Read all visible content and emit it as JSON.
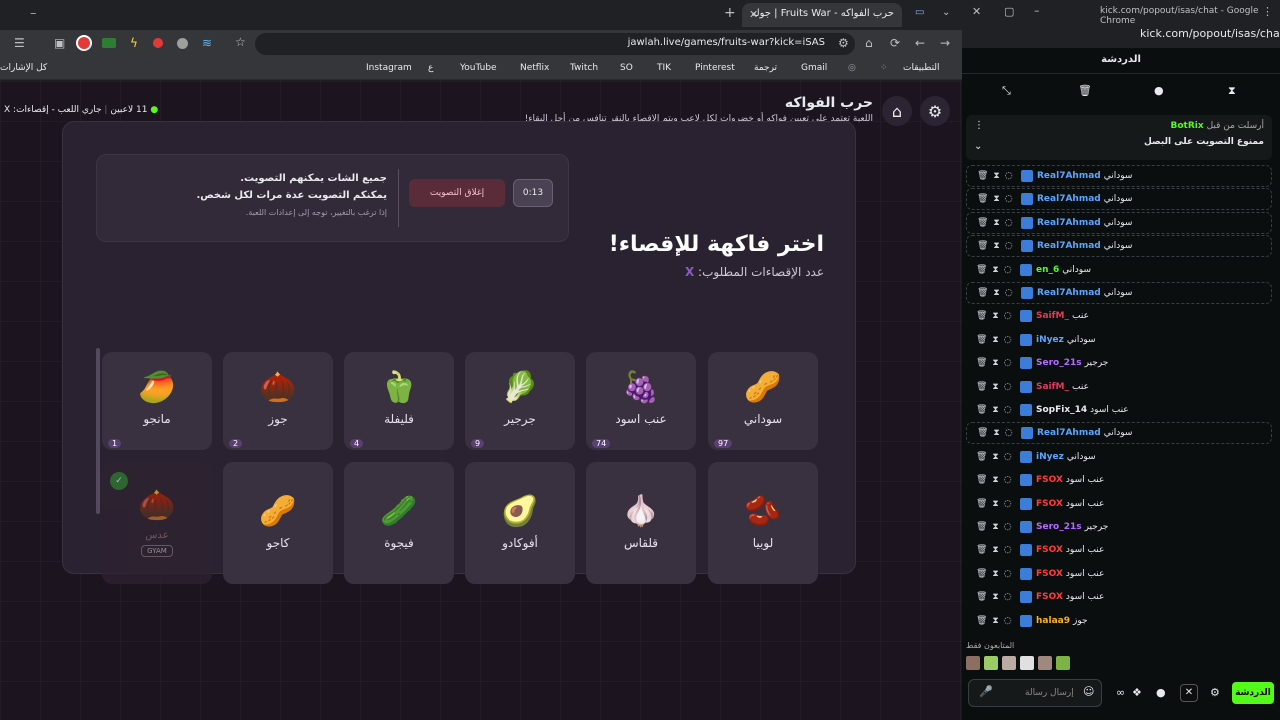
{
  "browser": {
    "tab_title": "حرب الفواكه - Fruits War | جوله",
    "url": "jawlah.live/games/fruits-war?kick=iSAS",
    "bookmarks": [
      {
        "label": "التطبيقات"
      },
      {
        "label": "Gmail"
      },
      {
        "label": "ترجمة"
      },
      {
        "label": "Pinterest"
      },
      {
        "label": "TIK"
      },
      {
        "label": "SO"
      },
      {
        "label": "Twitch"
      },
      {
        "label": "Netflix"
      },
      {
        "label": "YouTube"
      },
      {
        "label": "ع"
      },
      {
        "label": "Instagram"
      },
      {
        "label": "كل الإشارات"
      }
    ]
  },
  "game": {
    "title": "حرب الفواكه",
    "subtitle": "اللعبة تعتمد على تعيين فواكه أو خضروات لكل لاعب ويتم الإقصاء بالنقر تنافس من أجل البقاء!",
    "players": "11 لاعبين",
    "status": "جاري اللعب - إقصاءات: X",
    "heading": "اختر فاكهة للإقصاء!",
    "elim_label": "عدد الإقصاءات المطلوب:",
    "elim_value": "X",
    "timer": "0:13",
    "close_vote": "إغلاق التصويت",
    "info1": "جميع الشات يمكنهم التصويت.",
    "info2": "يمكنكم التصويت عدة مرات لكل شخص.",
    "info3": "إذا ترغب بالتغيير، توجه إلى إعدادات اللعبة.",
    "cards_row1": [
      {
        "name": "سوداني",
        "icon": "🥜",
        "votes": "97"
      },
      {
        "name": "عنب اسود",
        "icon": "🍇",
        "votes": "74"
      },
      {
        "name": "جرجير",
        "icon": "🥬",
        "votes": "9"
      },
      {
        "name": "فليفلة",
        "icon": "🫑",
        "votes": "4"
      },
      {
        "name": "جوز",
        "icon": "🌰",
        "votes": "2"
      },
      {
        "name": "مانجو",
        "icon": "🥭",
        "votes": "1"
      }
    ],
    "cards_row2": [
      {
        "name": "لوبيا",
        "icon": "🫘"
      },
      {
        "name": "قلقاس",
        "icon": "🧄"
      },
      {
        "name": "أفوكادو",
        "icon": "🥑"
      },
      {
        "name": "فيجوة",
        "icon": "🥒"
      },
      {
        "name": "كاجو",
        "icon": "🥜"
      },
      {
        "name": "عدس",
        "icon": "🌰",
        "eliminated": "GYAM"
      }
    ]
  },
  "chat": {
    "window_title": "kick.com/popout/isas/chat - Google Chrome",
    "url": "kick.com/popout/isas/chat",
    "header": "الدردشة",
    "pinned_by": "أرسلت من قبل",
    "pinned_user": "BotRix",
    "pinned_msg": "ممنوع التصويت على البصل",
    "messages": [
      {
        "user": "Real7Ahmad",
        "msg": "سوداني",
        "color": "#5aa6ff",
        "hl": true
      },
      {
        "user": "Real7Ahmad",
        "msg": "سوداني",
        "color": "#5aa6ff",
        "hl": true
      },
      {
        "user": "Real7Ahmad",
        "msg": "سوداني",
        "color": "#5aa6ff",
        "hl": true
      },
      {
        "user": "Real7Ahmad",
        "msg": "سوداني",
        "color": "#5aa6ff",
        "hl": true
      },
      {
        "user": "en_6",
        "msg": "سوداني",
        "color": "#53fc18",
        "hl": false
      },
      {
        "user": "Real7Ahmad",
        "msg": "سوداني",
        "color": "#5aa6ff",
        "hl": true
      },
      {
        "user": "SaifM_",
        "msg": "عنب",
        "color": "#e03a5c",
        "hl": false
      },
      {
        "user": "iNyez",
        "msg": "سوداني",
        "color": "#5aa6ff",
        "hl": false
      },
      {
        "user": "Sero_21s",
        "msg": "جرجير",
        "color": "#b36bff",
        "hl": false
      },
      {
        "user": "SaifM_",
        "msg": "عنب",
        "color": "#e03a5c",
        "hl": false
      },
      {
        "user": "SopFix_14",
        "msg": "عنب اسود",
        "color": "#e8eaed",
        "hl": false
      },
      {
        "user": "Real7Ahmad",
        "msg": "سوداني",
        "color": "#5aa6ff",
        "hl": true
      },
      {
        "user": "iNyez",
        "msg": "سوداني",
        "color": "#5aa6ff",
        "hl": false
      },
      {
        "user": "FSOX",
        "msg": "عنب اسود",
        "color": "#ff3b3b",
        "hl": false
      },
      {
        "user": "FSOX",
        "msg": "عنب اسود",
        "color": "#ff3b3b",
        "hl": false
      },
      {
        "user": "Sero_21s",
        "msg": "جرجير",
        "color": "#b36bff",
        "hl": false
      },
      {
        "user": "FSOX",
        "msg": "عنب اسود",
        "color": "#ff3b3b",
        "hl": false
      },
      {
        "user": "FSOX",
        "msg": "عنب اسود",
        "color": "#ff3b3b",
        "hl": false
      },
      {
        "user": "FSOX",
        "msg": "عنب اسود",
        "color": "#ff3b3b",
        "hl": false
      },
      {
        "user": "halaa9",
        "msg": "جوز",
        "color": "#ffb020",
        "hl": false
      }
    ],
    "viewers_label": "المتابعون فقط",
    "input_placeholder": "إرسال رسالة",
    "send_button": "الدردشة"
  }
}
